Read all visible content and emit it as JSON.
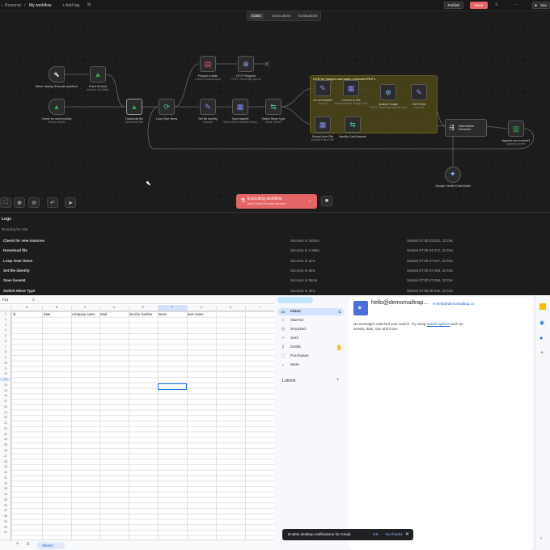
{
  "n8n": {
    "breadcrumb_project": "Personal",
    "workflow_name": "My workflow",
    "add_tag": "+ Add tag",
    "publish": "Publish",
    "save": "Save",
    "star": "Star",
    "tabs": [
      "Editor",
      "Executions",
      "Evaluations"
    ],
    "group_title": "OCR for images and badly extracted PDF's",
    "nodes": [
      {
        "name": "When clicking 'Execute workflow'",
        "sub": "",
        "icon": "cursor-icon",
        "color": "#dddddd"
      },
      {
        "name": "Fetch 30 docs",
        "sub": "search: list folder",
        "icon": "gdrive-icon",
        "color": "#34a853"
      },
      {
        "name": "Check for new invoices",
        "sub": "Every minute",
        "icon": "gdrive-icon",
        "color": "#34a853"
      },
      {
        "name": "Download file",
        "sub": "download: file",
        "icon": "gdrive-icon",
        "color": "#34a853"
      },
      {
        "name": "Loop Over Items",
        "sub": "",
        "icon": "loop-icon",
        "color": "#4cc38a"
      },
      {
        "name": "Prepare a table",
        "sub": "convert format input",
        "icon": "trash-icon",
        "color": "#e25c5c"
      },
      {
        "name": "HTTP Request",
        "sub": "POST: https://api.pdf.co",
        "icon": "globe-icon",
        "color": "#8ab4f8"
      },
      {
        "name": "Set file identity",
        "sub": "manual",
        "icon": "pen-icon",
        "color": "#9b8cf0"
      },
      {
        "name": "Save base64",
        "sub": "Move file to base64 string",
        "icon": "doc-icon",
        "color": "#7d8cf0"
      },
      {
        "name": "Switch Mime Type",
        "sub": "mode: Rules",
        "icon": "switch-icon",
        "color": "#4cc38a"
      },
      {
        "name": "No set base64",
        "sub": "manual",
        "icon": "pen-icon",
        "color": "#9b8cf0"
      },
      {
        "name": "Convert to File",
        "sub": "Move base64 string to file",
        "icon": "doc-icon",
        "color": "#7d8cf0"
      },
      {
        "name": "Analyze Image",
        "sub": "POST: https://api.openai.com",
        "icon": "globe-icon",
        "color": "#8ab4f8"
      },
      {
        "name": "Edit Fields",
        "sub": "manual",
        "icon": "pen-icon",
        "color": "#9b8cf0"
      },
      {
        "name": "Extract from File",
        "sub": "Extract From PDF",
        "icon": "doc-icon",
        "color": "#7d8cf0"
      },
      {
        "name": "Identify CamScanner",
        "sub": "",
        "icon": "switch-icon",
        "color": "#4cc38a"
      },
      {
        "name": "Information Extractor",
        "sub": "",
        "icon": "extract-icon",
        "color": "#cccccc"
      },
      {
        "name": "Append row in sheet2",
        "sub": "append: sheet",
        "icon": "sheets-icon",
        "color": "#34a853"
      },
      {
        "name": "Google Gemini Chat Model",
        "sub": "",
        "icon": "gemini-icon",
        "color": "#8ab4f8"
      }
    ],
    "executing": {
      "title": "Executing workflow",
      "sub": "from Check for new invoices"
    },
    "logs": {
      "title": "Logs",
      "running": "Running for 23s",
      "rows": [
        {
          "name": "Check for new invoices",
          "status": "Success in 440ms",
          "started": "Started 07:00:43.632, 22 Dec"
        },
        {
          "name": "Download file",
          "status": "Success in 1.569s",
          "started": "Started 07:00:44.072, 22 Dec"
        },
        {
          "name": "Loop Over Items",
          "status": "Success in 1ms",
          "started": "Started 07:00:47.047, 22 Dec"
        },
        {
          "name": "Set file identity",
          "status": "Success in 8ms",
          "started": "Started 07:00:47.048, 22 Dec"
        },
        {
          "name": "Save base64",
          "status": "Success in 55ms",
          "started": "Started 07:00:47.056, 22 Dec"
        },
        {
          "name": "Switch Mime Type",
          "status": "Success in 3ms",
          "started": "Started 07:00:48.616, 22 Dec"
        }
      ]
    }
  },
  "sheets": {
    "cell_ref": "F13",
    "fx": "fx",
    "columns": [
      "A",
      "B",
      "C",
      "D",
      "E",
      "F",
      "G",
      "H",
      "I"
    ],
    "headers": [
      "id",
      "date",
      "company name",
      "total",
      "invoice number",
      "taxes",
      "loan name",
      "",
      ""
    ],
    "rows": [
      "1",
      "2",
      "3",
      "4",
      "5",
      "6",
      "7",
      "8",
      "9",
      "10",
      "11",
      "12",
      "13",
      "14",
      "15",
      "16",
      "17",
      "18",
      "19",
      "20",
      "21",
      "22",
      "23",
      "24",
      "25",
      "26",
      "27",
      "28",
      "29",
      "30",
      "31",
      "32",
      "33",
      "34",
      "35",
      "36",
      "37",
      "38",
      "39",
      "40",
      "41"
    ],
    "sheet_tab": "Sheet1"
  },
  "gmail": {
    "items": [
      {
        "label": "Inbox",
        "count": "1",
        "icon": "inbox-icon"
      },
      {
        "label": "Starred",
        "count": "",
        "icon": "star-icon"
      },
      {
        "label": "Snoozed",
        "count": "",
        "icon": "clock-icon"
      },
      {
        "label": "Sent",
        "count": "",
        "icon": "send-icon"
      },
      {
        "label": "Drafts",
        "count": "",
        "icon": "draft-icon"
      },
      {
        "label": "Purchases",
        "count": "",
        "icon": "tag-icon"
      },
      {
        "label": "More",
        "count": "",
        "icon": "chevron-down-icon"
      }
    ],
    "labels_heading": "Labels",
    "account": "hello@demomailtrap...",
    "account_email": "hello@demomailtrap.co",
    "empty_message_pre": "No messages matched your search. Try using ",
    "empty_link": "search options",
    "empty_message_post": " such as sender, date, size and more.",
    "snackbar": {
      "text": "Enable desktop notifications for Gmail.",
      "ok": "OK",
      "no": "No thanks"
    }
  }
}
